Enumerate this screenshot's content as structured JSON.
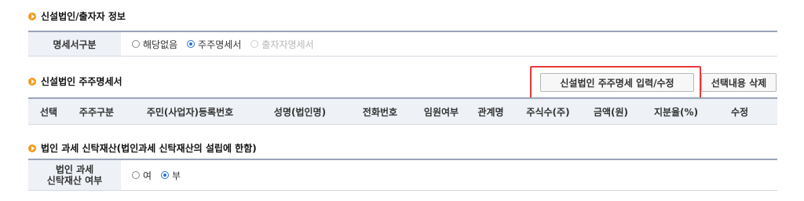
{
  "section1": {
    "title": "신설법인/출자자 정보",
    "row_label": "명세서구분",
    "options": [
      {
        "label": "해당없음",
        "selected": false,
        "disabled": false
      },
      {
        "label": "주주명세서",
        "selected": true,
        "disabled": false
      },
      {
        "label": "출자자명세서",
        "selected": false,
        "disabled": true
      }
    ]
  },
  "section2": {
    "title": "신설법인 주주명세서",
    "input_button": "신설법인 주주명세 입력/수정",
    "delete_button": "선택내용 삭제",
    "columns": [
      "선택",
      "주주구분",
      "주민(사업자)등록번호",
      "성명(법인명)",
      "전화번호",
      "임원여부",
      "관계명",
      "주식수(주)",
      "금액(원)",
      "지분율(%)",
      "수정"
    ]
  },
  "section3": {
    "title": "법인 과세 신탁재산(법인과세 신탁재산의 설립에 한함)",
    "row_label_line1": "법인 과세",
    "row_label_line2": "신탁재산 여부",
    "options": [
      {
        "label": "여",
        "selected": false
      },
      {
        "label": "부",
        "selected": true
      }
    ]
  },
  "colors": {
    "accent_orange": "#f29a1a",
    "header_bg": "#eef1f6",
    "highlight_red": "#e8383a",
    "radio_blue": "#2f6fd6"
  }
}
